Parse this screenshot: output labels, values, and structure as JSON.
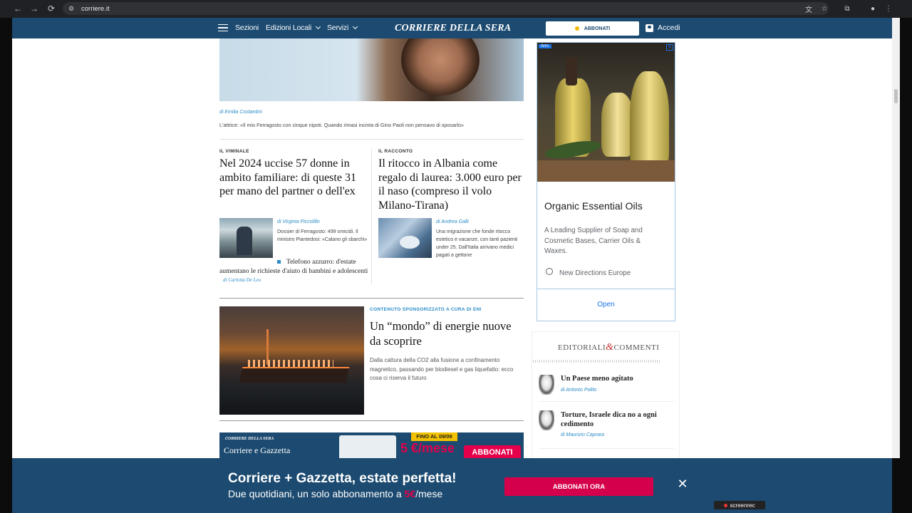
{
  "browser": {
    "url": "corriere.it"
  },
  "header": {
    "sections": "Sezioni",
    "edizioni": "Edizioni Locali",
    "servizi": "Servizi",
    "logo": "CORRIERE DELLA SERA",
    "abbonati": "ABBONATI",
    "accedi": "Accedi"
  },
  "top_story": {
    "author": "di Emilia Costantini",
    "summary": "L'attrice: «Il mio Ferragosto con cinque nipoti. Quando rimasi incinta di Gino Paoli non pensavo di sposarlo»"
  },
  "story_left": {
    "kicker": "IL VIMINALE",
    "headline": "Nel 2024 uccise 57 donne in ambito familiare: di queste 31 per mano del partner o dell'ex",
    "author": "di Virginia Piccolillo",
    "summary": "Dossier di Ferragosto: 499 omicidi. Il ministro Piantedosi: «Calano gli sbarchi»",
    "related": "Telefono azzurro: d'estate aumentano le richieste d'aiuto di bambini e adolescenti",
    "related_author": "di Carlotta De Leo"
  },
  "story_right": {
    "kicker": "IL RACCONTO",
    "headline": "Il ritocco in Albania come regalo di laurea: 3.000 euro per il naso (compreso il volo Milano-Tirana)",
    "author": "di Andrea Galli",
    "summary": "Una migrazione che fonde ritocco estetico e vacanze, con tanti pazienti under 25. Dall'Italia arrivano medici pagati a gettone"
  },
  "sponsored": {
    "kicker": "CONTENUTO SPONSORIZZATO A CURA DI ENI",
    "headline": "Un “mondo” di energie nuove da scoprire",
    "summary": "Dalla cattura della CO2 alla fusione a confinamento magnetico, passando per biodiesel e gas liquefatto: ecco cosa ci riserva il futuro"
  },
  "promo_strip": {
    "brand": "CORRIERE DELLA SERA",
    "title": "Corriere e Gazzetta",
    "badge": "FINO AL 09/09",
    "price": "5 €/mese",
    "cta": "ABBONATI"
  },
  "ad": {
    "label": "Ann.",
    "title": "Organic Essential Oils",
    "description": "A Leading Supplier of Soap and Cosmetic Bases, Carrier Oils & Waxes.",
    "brand": "New Directions Europe",
    "open": "Open"
  },
  "editoriali": {
    "title_a": "EDITORIALI",
    "amp": "&",
    "title_b": "COMMENTI",
    "items": [
      {
        "headline": "Un Paese meno agitato",
        "author": "di Antonio Polito"
      },
      {
        "headline": "Torture, Israele dica no a ogni cedimento",
        "author": "di Maurizio Caprara"
      }
    ]
  },
  "banner": {
    "title": "Corriere + Gazzetta, estate perfetta!",
    "subtitle": "Due quotidiani, un solo abbonamento a ",
    "price": "5€",
    "suffix": "/mese",
    "cta": "ABBONATI ORA"
  },
  "recorder": "screenrec"
}
